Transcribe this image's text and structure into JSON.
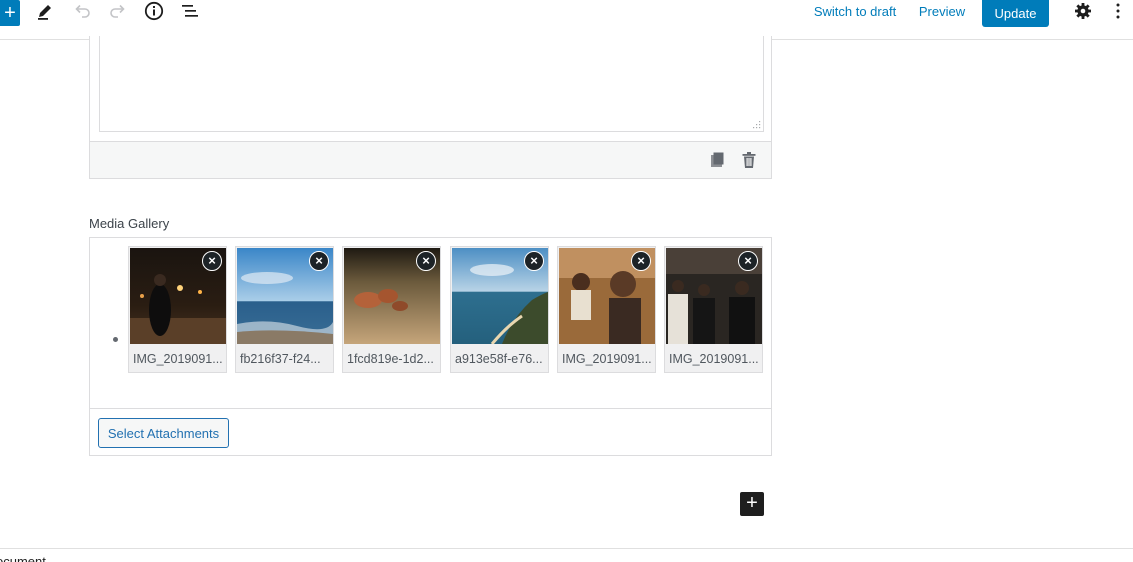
{
  "toolbar": {
    "inserter_icon": "plus-icon",
    "tool_icon": "pencil-icon",
    "undo_icon": "undo-icon",
    "redo_icon": "redo-icon",
    "info_icon": "info-icon",
    "outline_icon": "list-view-icon",
    "switch_to_draft": "Switch to draft",
    "preview": "Preview",
    "update": "Update",
    "settings_icon": "gear-icon",
    "more_icon": "more-vertical-icon",
    "plus_glyph": "+"
  },
  "upper_block": {
    "duplicate_icon": "copy-icon",
    "delete_icon": "trash-icon"
  },
  "gallery": {
    "label": "Media Gallery",
    "remove_glyph": "×",
    "items": [
      {
        "name": "IMG_2019091..."
      },
      {
        "name": "fb216f37-f24..."
      },
      {
        "name": "1fcd819e-1d2..."
      },
      {
        "name": "a913e58f-e76..."
      },
      {
        "name": "IMG_2019091..."
      },
      {
        "name": "IMG_2019091..."
      }
    ],
    "select_button": "Select Attachments"
  },
  "add_block": {
    "glyph": "+"
  },
  "footer": {
    "breadcrumb": "ocument"
  },
  "colors": {
    "accent": "#007cba",
    "button_outline": "#2271b1",
    "border": "#dcdcde"
  }
}
